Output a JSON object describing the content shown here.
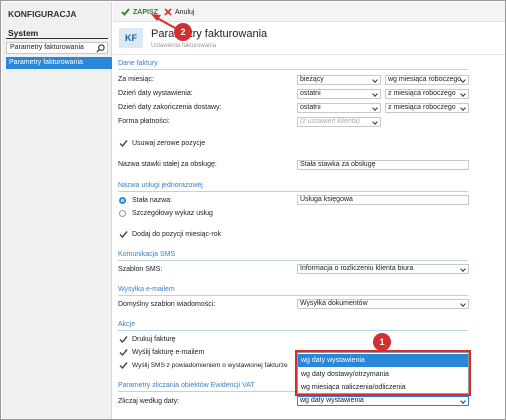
{
  "left_panel": {
    "title": "KONFIGURACJA",
    "section": "System",
    "search_value": "Parametry fakturowania",
    "selected_item": "Parametry fakturowania"
  },
  "toolbar": {
    "save_label": "ZAPISZ",
    "cancel_label": "Anuluj"
  },
  "header": {
    "badge": "KF",
    "title": "Parametry fakturowania",
    "subtitle": "Ustawienia fakturowania"
  },
  "sections": {
    "dane_faktury": "Dane faktury",
    "nazwa_uslugi": "Nazwa usługi jednorazowej",
    "sms": "Komunikacja SMS",
    "email": "Wysyłka e-mailem",
    "akcje": "Akcje",
    "vat": "Parametry zliczania obiektów Ewidencji VAT"
  },
  "fields": {
    "za_miesiac": {
      "label": "Za miesiąc:",
      "value": "bieżący",
      "value2": "wg miesiąca roboczego"
    },
    "dzien_wyst": {
      "label": "Dzień daty wystawienia:",
      "value": "ostatni",
      "value2": "z miesiąca roboczego"
    },
    "dzien_zak": {
      "label": "Dzień daty zakończenia dostawy:",
      "value": "ostatni",
      "value2": "z miesiąca roboczego"
    },
    "forma": {
      "label": "Forma płatności:",
      "placeholder": "(z ustawień klienta)"
    },
    "usuwaj": {
      "label": "Usuwaj zerowe pozycje"
    },
    "stawka": {
      "label": "Nazwa stawki stałej za obsługę:",
      "value": "Stała stawka za obsługę"
    },
    "stala_nazwa": {
      "label": "Stała nazwa:",
      "value": "Usługa księgowa"
    },
    "szczegolowy": {
      "label": "Szczegółowy wykaz usług"
    },
    "dodaj": {
      "label": "Dodaj do pozycji miesiąc-rok"
    },
    "szablon_sms": {
      "label": "Szablon SMS:",
      "value": "Informacja o rozliczeniu klienta biura"
    },
    "szablon_email": {
      "label": "Domyślny szablon wiadomości:",
      "value": "Wysyłka dokumentów"
    },
    "drukuj": {
      "label": "Drukuj fakturę"
    },
    "wyslij_email": {
      "label": "Wyślij fakturę e-mailem"
    },
    "wyslij_sms": {
      "label": "Wyślij SMS z powiadomieniem o wystawionej fakturze"
    },
    "zliczaj": {
      "label": "Zliczaj według daty:",
      "value": "wg daty wystawienia"
    }
  },
  "dropdown_options": [
    "wg daty wystawienia",
    "wg daty dostawy/otrzymania",
    "wg miesiąca naliczenia/odliczenia"
  ],
  "annotations": {
    "badge1": "1",
    "badge2": "2"
  },
  "colors": {
    "accent": "#2a86d8",
    "annotation": "#d32f2f",
    "save": "#2e7d32",
    "section": "#3b7fc4"
  }
}
